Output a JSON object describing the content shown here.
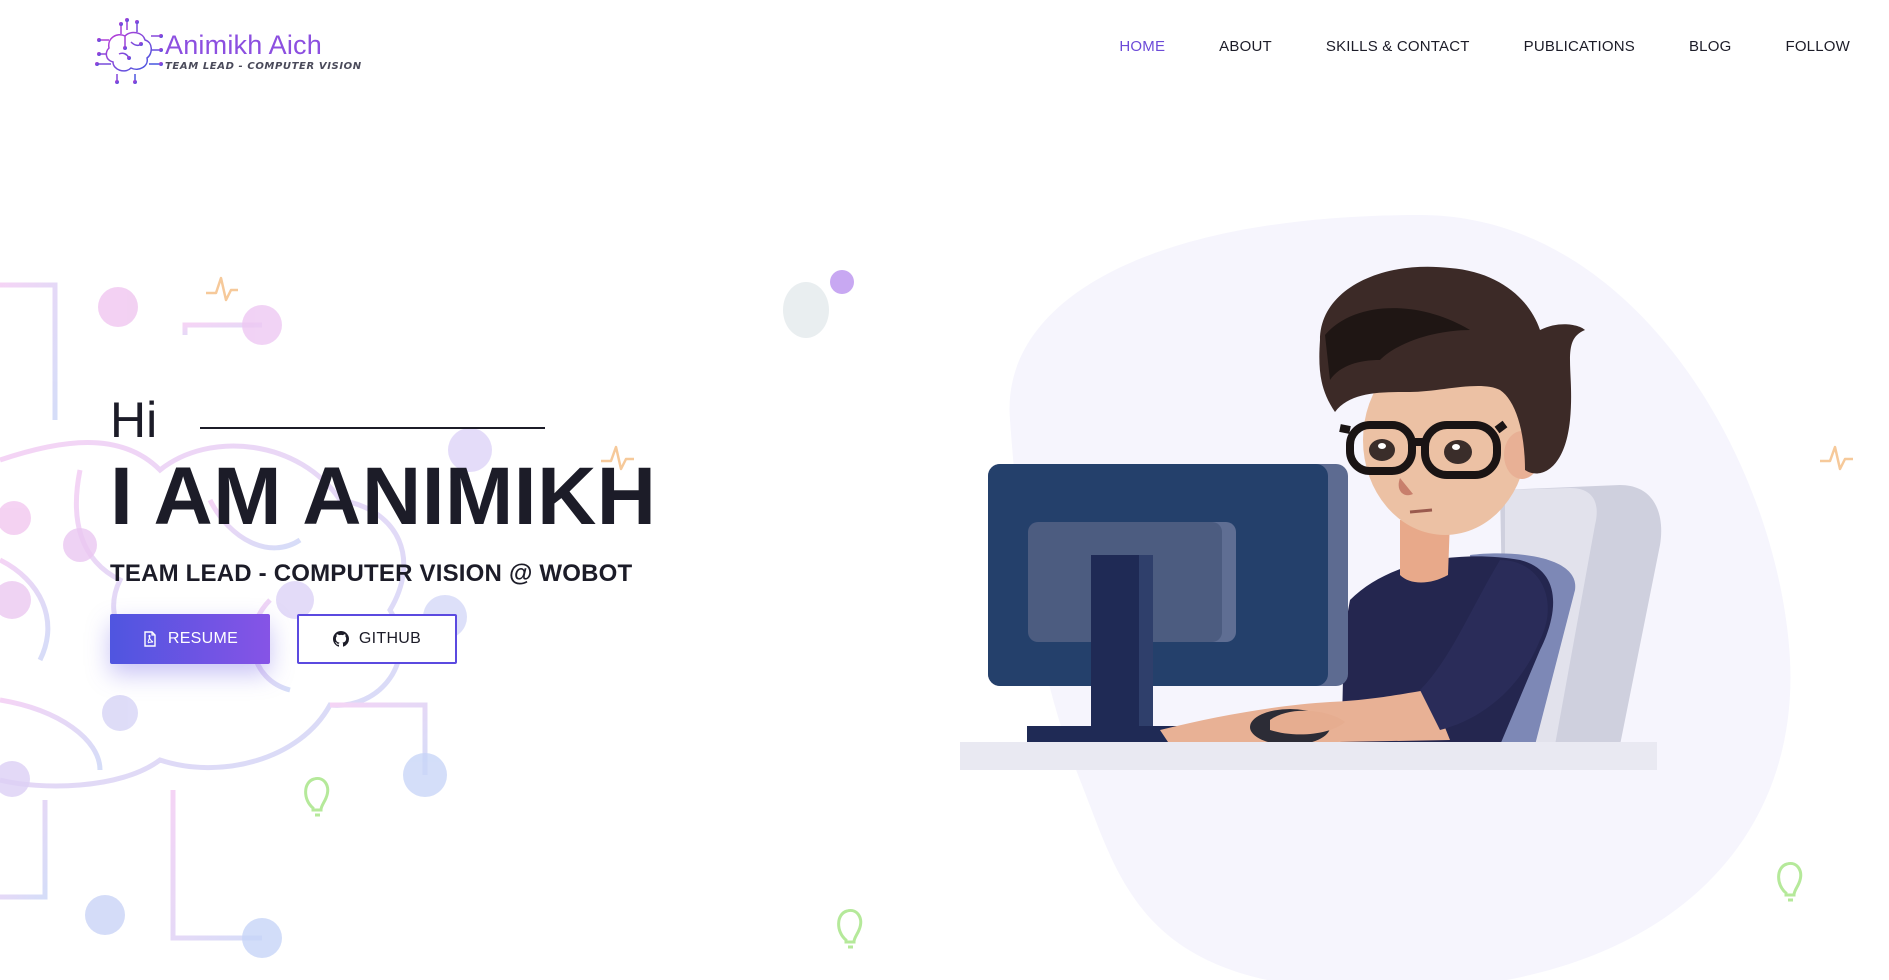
{
  "brand": {
    "name": "Animikh Aich",
    "tagline": "TEAM LEAD - COMPUTER VISION"
  },
  "nav": {
    "items": [
      {
        "label": "HOME",
        "active": true
      },
      {
        "label": "ABOUT",
        "active": false
      },
      {
        "label": "SKILLS & CONTACT",
        "active": false
      },
      {
        "label": "PUBLICATIONS",
        "active": false
      },
      {
        "label": "BLOG",
        "active": false
      },
      {
        "label": "FOLLOW",
        "active": false
      }
    ]
  },
  "hero": {
    "greeting": "Hi",
    "title": "I AM ANIMIKH",
    "subtitle": "TEAM LEAD - COMPUTER VISION @ WOBOT",
    "resume_label": "RESUME",
    "github_label": "GITHUB"
  },
  "icons": {
    "logo": "brain-circuit-icon",
    "resume": "pdf-file-icon",
    "github": "github-icon"
  },
  "colors": {
    "accent": "#6c4ad8",
    "brand": "#8c4fe0",
    "button_gradient_start": "#4f55e0",
    "button_gradient_end": "#8654e6",
    "text": "#1c1c28",
    "blob": "#f6f5fd"
  }
}
